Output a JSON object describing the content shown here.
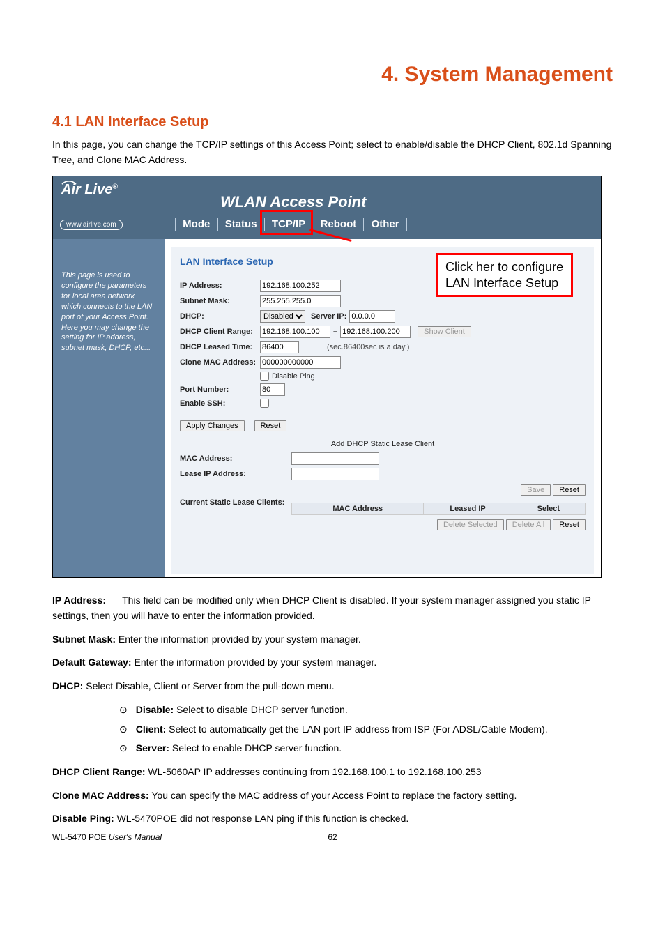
{
  "chapter_title": "4. System Management",
  "section_title": "4.1 LAN Interface Setup",
  "intro": "In this page, you can change the TCP/IP settings of this Access Point; select to enable/disable the DHCP Client, 802.1d Spanning Tree, and Clone MAC Address.",
  "screenshot": {
    "brand": "Air Live",
    "brand_url": "www.airlive.com",
    "ap_title": "WLAN Access Point",
    "tabs": {
      "mode": "Mode",
      "status": "Status",
      "tcpip": "TCP/IP",
      "reboot": "Reboot",
      "other": "Other"
    },
    "sidebar_text": "This page is used to configure the parameters for local area network which connects to the LAN port of your Access Point. Here you may change the setting for IP address, subnet mask, DHCP, etc...",
    "lan_title": "LAN Interface Setup",
    "fields": {
      "ip_label": "IP Address:",
      "ip_value": "192.168.100.252",
      "mask_label": "Subnet Mask:",
      "mask_value": "255.255.255.0",
      "dhcp_label": "DHCP:",
      "dhcp_value": "Disabled",
      "serverip_label": "Server IP:",
      "serverip_value": "0.0.0.0",
      "range_label": "DHCP Client Range:",
      "range_from": "192.168.100.100",
      "range_to": "192.168.100.200",
      "range_sep": "–",
      "show_client": "Show Client",
      "lease_label": "DHCP Leased Time:",
      "lease_value": "86400",
      "lease_note": "(sec.86400sec is a day.)",
      "clone_label": "Clone MAC Address:",
      "clone_value": "000000000000",
      "disable_ping_label": "Disable Ping",
      "port_label": "Port Number:",
      "port_value": "80",
      "ssh_label": "Enable SSH:"
    },
    "buttons": {
      "apply": "Apply Changes",
      "reset": "Reset",
      "save": "Save",
      "reset2": "Reset",
      "del_sel": "Delete Selected",
      "del_all": "Delete All",
      "reset3": "Reset"
    },
    "static_lease": {
      "title": "Add DHCP Static Lease Client",
      "mac_label": "MAC Address:",
      "leaseip_label": "Lease IP Address:",
      "current_label": "Current Static Lease Clients:",
      "th_mac": "MAC Address",
      "th_leased": "Leased IP",
      "th_select": "Select"
    },
    "callout": "Click her to configure LAN Interface Setup"
  },
  "descriptions": {
    "ip_label": "IP Address:",
    "ip_text": "This field can be modified only when DHCP Client is disabled. If your system manager assigned you static IP settings, then you will have to enter the information provided.",
    "mask_label": "Subnet Mask:",
    "mask_text": " Enter the information provided by your system manager.",
    "gateway_label": "Default Gateway:",
    "gateway_text": " Enter the information provided by your system manager.",
    "dhcp_label": "DHCP:",
    "dhcp_text": " Select Disable, Client or Server from the pull-down menu.",
    "bullets": [
      {
        "label": "Disable:",
        "text": " Select to disable DHCP server function."
      },
      {
        "label": "Client:",
        "text": " Select to automatically get the LAN port IP address from ISP (For ADSL/Cable Modem)."
      },
      {
        "label": "Server:",
        "text": " Select to enable DHCP server function."
      }
    ],
    "range_label": "DHCP Client Range:",
    "range_text": " WL-5060AP IP addresses continuing from 192.168.100.1 to 192.168.100.253",
    "clone_label": "Clone MAC Address:",
    "clone_text": " You can specify the MAC address of your Access Point to replace the factory setting.",
    "ping_label": "Disable Ping:",
    "ping_text": " WL-5470POE did not response LAN ping if this function is checked."
  },
  "footer": {
    "manual": "WL-5470 POE",
    "manual_suffix": " User's Manual",
    "page": "62"
  }
}
